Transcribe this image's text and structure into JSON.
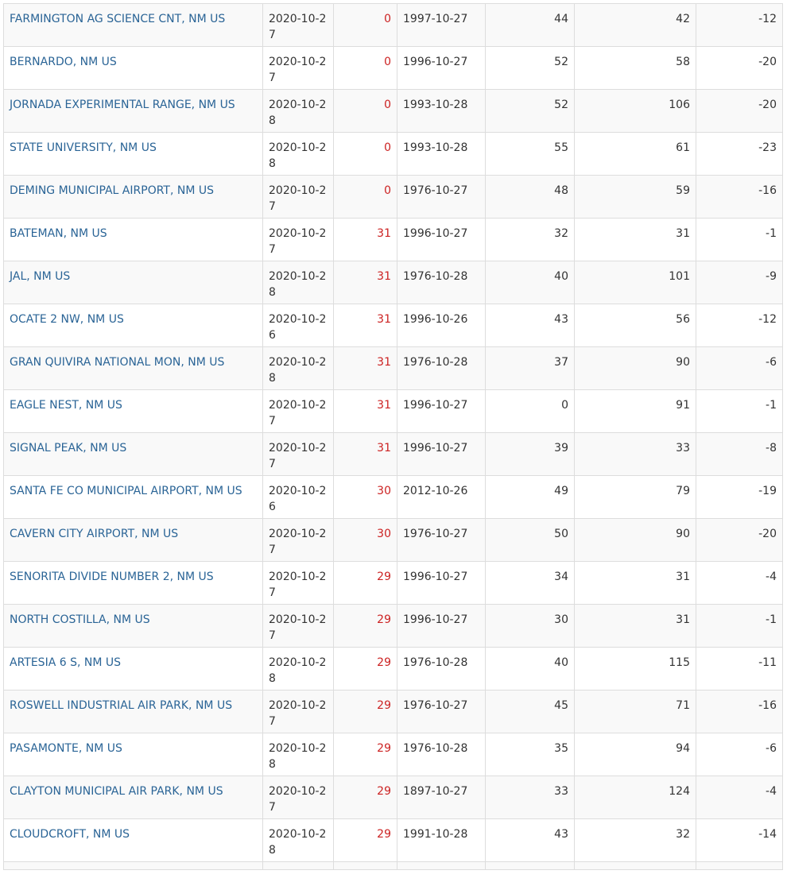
{
  "colors": {
    "link": "#2a6496",
    "value_red": "#cc2222",
    "text": "#333333",
    "border": "#dddddd",
    "stripe": "#f9f9f9"
  },
  "rows": [
    {
      "station": "FARMINGTON AG SCIENCE CNT, NM US",
      "date": "2020-10-27",
      "value": "0",
      "record_date": "1997-10-27",
      "n1": "44",
      "n2": "42",
      "n3": "-12"
    },
    {
      "station": "BERNARDO, NM US",
      "date": "2020-10-27",
      "value": "0",
      "record_date": "1996-10-27",
      "n1": "52",
      "n2": "58",
      "n3": "-20"
    },
    {
      "station": "JORNADA EXPERIMENTAL RANGE, NM US",
      "date": "2020-10-28",
      "value": "0",
      "record_date": "1993-10-28",
      "n1": "52",
      "n2": "106",
      "n3": "-20"
    },
    {
      "station": "STATE UNIVERSITY, NM US",
      "date": "2020-10-28",
      "value": "0",
      "record_date": "1993-10-28",
      "n1": "55",
      "n2": "61",
      "n3": "-23"
    },
    {
      "station": "DEMING MUNICIPAL AIRPORT, NM US",
      "date": "2020-10-27",
      "value": "0",
      "record_date": "1976-10-27",
      "n1": "48",
      "n2": "59",
      "n3": "-16"
    },
    {
      "station": "BATEMAN, NM US",
      "date": "2020-10-27",
      "value": "31",
      "record_date": "1996-10-27",
      "n1": "32",
      "n2": "31",
      "n3": "-1"
    },
    {
      "station": "JAL, NM US",
      "date": "2020-10-28",
      "value": "31",
      "record_date": "1976-10-28",
      "n1": "40",
      "n2": "101",
      "n3": "-9"
    },
    {
      "station": "OCATE 2 NW, NM US",
      "date": "2020-10-26",
      "value": "31",
      "record_date": "1996-10-26",
      "n1": "43",
      "n2": "56",
      "n3": "-12"
    },
    {
      "station": "GRAN QUIVIRA NATIONAL MON, NM US",
      "date": "2020-10-28",
      "value": "31",
      "record_date": "1976-10-28",
      "n1": "37",
      "n2": "90",
      "n3": "-6"
    },
    {
      "station": "EAGLE NEST, NM US",
      "date": "2020-10-27",
      "value": "31",
      "record_date": "1996-10-27",
      "n1": "0",
      "n2": "91",
      "n3": "-1"
    },
    {
      "station": "SIGNAL PEAK, NM US",
      "date": "2020-10-27",
      "value": "31",
      "record_date": "1996-10-27",
      "n1": "39",
      "n2": "33",
      "n3": "-8"
    },
    {
      "station": "SANTA FE CO MUNICIPAL AIRPORT, NM US",
      "date": "2020-10-26",
      "value": "30",
      "record_date": "2012-10-26",
      "n1": "49",
      "n2": "79",
      "n3": "-19"
    },
    {
      "station": "CAVERN CITY AIRPORT, NM US",
      "date": "2020-10-27",
      "value": "30",
      "record_date": "1976-10-27",
      "n1": "50",
      "n2": "90",
      "n3": "-20"
    },
    {
      "station": "SENORITA DIVIDE NUMBER 2, NM US",
      "date": "2020-10-27",
      "value": "29",
      "record_date": "1996-10-27",
      "n1": "34",
      "n2": "31",
      "n3": "-4"
    },
    {
      "station": "NORTH COSTILLA, NM US",
      "date": "2020-10-27",
      "value": "29",
      "record_date": "1996-10-27",
      "n1": "30",
      "n2": "31",
      "n3": "-1"
    },
    {
      "station": "ARTESIA 6 S, NM US",
      "date": "2020-10-28",
      "value": "29",
      "record_date": "1976-10-28",
      "n1": "40",
      "n2": "115",
      "n3": "-11"
    },
    {
      "station": "ROSWELL INDUSTRIAL AIR PARK, NM US",
      "date": "2020-10-27",
      "value": "29",
      "record_date": "1976-10-27",
      "n1": "45",
      "n2": "71",
      "n3": "-16"
    },
    {
      "station": "PASAMONTE, NM US",
      "date": "2020-10-28",
      "value": "29",
      "record_date": "1976-10-28",
      "n1": "35",
      "n2": "94",
      "n3": "-6"
    },
    {
      "station": "CLAYTON MUNICIPAL AIR PARK, NM US",
      "date": "2020-10-27",
      "value": "29",
      "record_date": "1897-10-27",
      "n1": "33",
      "n2": "124",
      "n3": "-4"
    },
    {
      "station": "CLOUDCROFT, NM US",
      "date": "2020-10-28",
      "value": "29",
      "record_date": "1991-10-28",
      "n1": "43",
      "n2": "32",
      "n3": "-14"
    }
  ]
}
